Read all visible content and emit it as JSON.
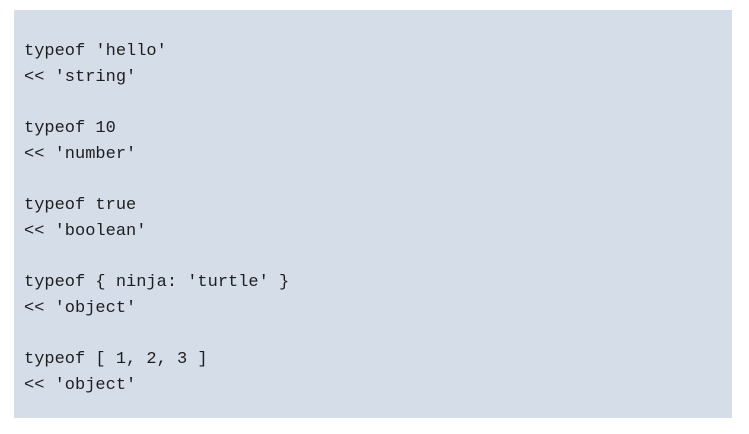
{
  "colors": {
    "panel_background": "#d5dde9",
    "text": "#1e1e1e"
  },
  "blocks": [
    {
      "input": "typeof 'hello'",
      "output": "<< 'string'"
    },
    {
      "input": "typeof 10",
      "output": "<< 'number'"
    },
    {
      "input": "typeof true",
      "output": "<< 'boolean'"
    },
    {
      "input": "typeof { ninja: 'turtle' }",
      "output": "<< 'object'"
    },
    {
      "input": "typeof [ 1, 2, 3 ]",
      "output": "<< 'object'"
    }
  ]
}
